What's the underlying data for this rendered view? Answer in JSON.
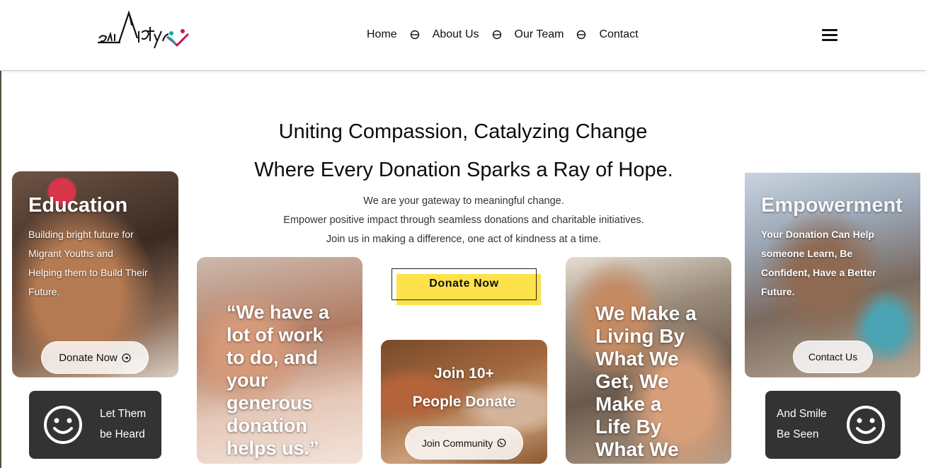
{
  "brand": {
    "logo_text": "adidfyr"
  },
  "nav": {
    "items": [
      "Home",
      "About Us",
      "Our Team",
      "Contact"
    ]
  },
  "hero": {
    "title_line1": "Uniting Compassion, Catalyzing Change",
    "title_line2": "Where Every Donation Sparks a Ray of Hope.",
    "lines": [
      "We are your gateway to meaningful change.",
      "Empower positive impact through seamless donations and charitable initiatives.",
      "Join us in making a difference, one act of kindness at a time."
    ],
    "donate_button": "Donate Now"
  },
  "cards": {
    "education": {
      "title": "Education",
      "text_lines": [
        "Building bright future for",
        "Migrant Youths and",
        "Helping them to Build Their",
        "Future."
      ],
      "button": "Donate Now"
    },
    "let_them": {
      "lines": [
        "Let Them",
        "be Heard"
      ]
    },
    "quote": {
      "lines": [
        "“We have a",
        "lot of work",
        "to do, and",
        "your",
        "generous",
        "donation",
        "helps us.”"
      ]
    },
    "community": {
      "lines": [
        "Join 10+",
        "People Donate"
      ],
      "button": "Join Community"
    },
    "living": {
      "lines": [
        "We Make a",
        "Living By",
        "What We",
        "Get, We",
        "Make a",
        "Life By",
        "What We"
      ]
    },
    "empowerment": {
      "title": "Empowerment",
      "text_lines": [
        "Your Donation Can Help",
        "someone Learn, Be",
        "Confident, Have a Better",
        "Future."
      ],
      "button": "Contact Us"
    },
    "smile": {
      "lines": [
        "And Smile",
        "Be Seen"
      ]
    }
  },
  "colors": {
    "accent_yellow": "#fde24a",
    "dark_card": "#333333",
    "logo_teal": "#1aa3a8",
    "logo_magenta": "#c2185b"
  },
  "icons": [
    "menu-icon",
    "circle-separator-icon",
    "arrow-circle-icon",
    "whatsapp-icon",
    "smiley-icon"
  ]
}
